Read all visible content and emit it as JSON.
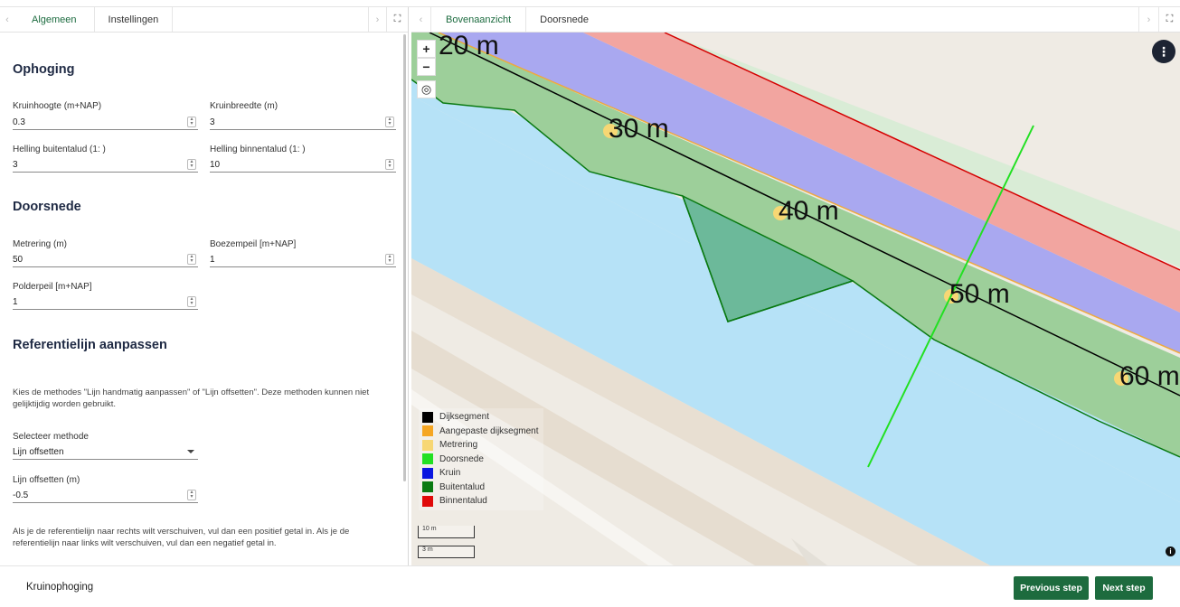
{
  "left_panel": {
    "tabs": [
      "Algemeen",
      "Instellingen"
    ],
    "sections": {
      "ophoging": "Ophoging",
      "doorsnede": "Doorsnede",
      "referentielijn": "Referentielijn aanpassen"
    },
    "fields": {
      "kruinhoogte": {
        "label": "Kruinhoogte (m+NAP)",
        "value": "0.3"
      },
      "kruinbreedte": {
        "label": "Kruinbreedte (m)",
        "value": "3"
      },
      "helling_buiten": {
        "label": "Helling buitentalud (1: )",
        "value": "3"
      },
      "helling_binnen": {
        "label": "Helling binnentalud (1: )",
        "value": "10"
      },
      "metrering": {
        "label": "Metrering (m)",
        "value": "50"
      },
      "boezempeil": {
        "label": "Boezempeil [m+NAP]",
        "value": "1"
      },
      "polderpeil": {
        "label": "Polderpeil [m+NAP]",
        "value": "1"
      },
      "methode": {
        "label": "Selecteer methode",
        "value": "Lijn offsetten"
      },
      "lijn_offset": {
        "label": "Lijn offsetten (m)",
        "value": "-0.5"
      }
    },
    "help_methode": "Kies de methodes \"Lijn handmatig aanpassen\" of \"Lijn offsetten\". Deze methoden kunnen niet gelijktijdig worden gebruikt.",
    "help_offset": "Als je de referentielijn naar rechts wilt verschuiven, vul dan een positief getal in. Als je de referentielijn naar links wilt verschuiven, vul dan een negatief getal in."
  },
  "map_panel": {
    "tabs": [
      "Bovenaanzicht",
      "Doorsnede"
    ],
    "controls": {
      "zoom_in": "+",
      "zoom_out": "−"
    },
    "distance_labels": [
      "20 m",
      "30 m",
      "40 m",
      "50 m",
      "60 m"
    ],
    "legend": [
      {
        "label": "Dijksegment",
        "color": "#000000"
      },
      {
        "label": "Aangepaste dijksegment",
        "color": "#f5a623"
      },
      {
        "label": "Metrering",
        "color": "#f7d774"
      },
      {
        "label": "Doorsnede",
        "color": "#22e022"
      },
      {
        "label": "Kruin",
        "color": "#0a16e0"
      },
      {
        "label": "Buitentalud",
        "color": "#0a7a12"
      },
      {
        "label": "Binnentalud",
        "color": "#e00a0a"
      }
    ],
    "scale": [
      "10 m",
      "3 m"
    ]
  },
  "footer": {
    "title": "Kruinophoging",
    "previous": "Previous step",
    "next": "Next step"
  }
}
